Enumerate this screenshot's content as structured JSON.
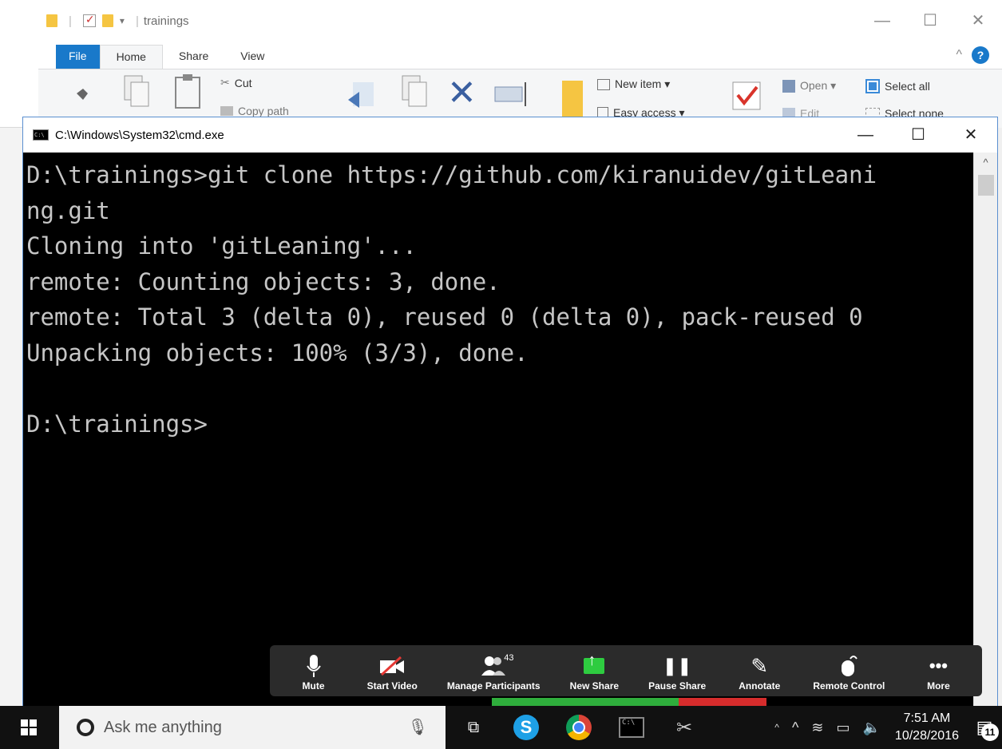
{
  "explorer": {
    "title": "trainings",
    "tabs": [
      {
        "label": "File"
      },
      {
        "label": "Home"
      },
      {
        "label": "Share"
      },
      {
        "label": "View"
      }
    ],
    "ribbon": {
      "cut": "Cut",
      "copy_path": "Copy path",
      "new_item": "New item ▾",
      "easy_access": "Easy access ▾",
      "open": "Open ▾",
      "edit": "Edit",
      "select_all": "Select all",
      "select_none": "Select none"
    },
    "help_label": "?"
  },
  "cmd": {
    "title": "C:\\Windows\\System32\\cmd.exe",
    "icon_text": "C:\\",
    "lines": [
      "D:\\trainings>git clone https://github.com/kiranuidev/gitLeani",
      "ng.git",
      "Cloning into 'gitLeaning'...",
      "remote: Counting objects: 3, done.",
      "remote: Total 3 (delta 0), reused 0 (delta 0), pack-reused 0",
      "Unpacking objects: 100% (3/3), done.",
      "",
      "D:\\trainings>"
    ]
  },
  "zoom": {
    "items": [
      {
        "label": "Mute"
      },
      {
        "label": "Start Video"
      },
      {
        "label": "Manage Participants",
        "badge": "43"
      },
      {
        "label": "New Share"
      },
      {
        "label": "Pause Share"
      },
      {
        "label": "Annotate"
      },
      {
        "label": "Remote Control"
      },
      {
        "label": "More"
      }
    ]
  },
  "taskbar": {
    "search_placeholder": "Ask me anything",
    "time": "7:51 AM",
    "date": "10/28/2016",
    "notification_count": "11"
  }
}
